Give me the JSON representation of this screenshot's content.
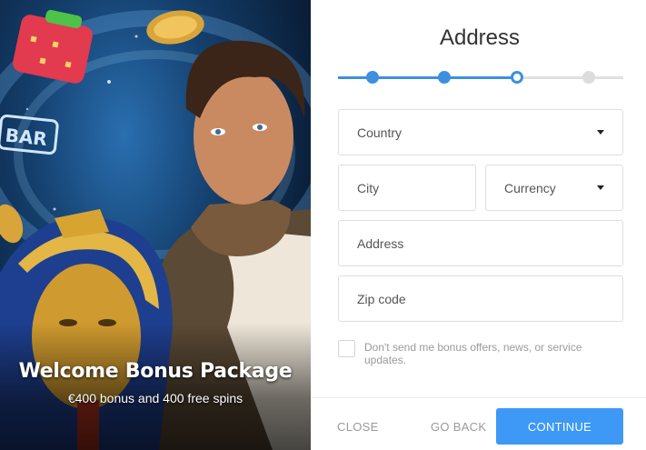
{
  "promo": {
    "title": "Welcome Bonus Package",
    "subtitle": "€400 bonus and 400 free spins",
    "icons": [
      "strawberry-icon",
      "bar-symbol-icon",
      "coin-icon",
      "explorer-illustration",
      "pharaoh-illustration"
    ]
  },
  "form": {
    "title": "Address",
    "stepper": {
      "total_steps": 4,
      "current_step": 3
    },
    "fields": {
      "country": {
        "placeholder": "Country"
      },
      "city": {
        "placeholder": "City"
      },
      "currency": {
        "placeholder": "Currency"
      },
      "address": {
        "placeholder": "Address"
      },
      "zip": {
        "placeholder": "Zip code"
      }
    },
    "consent_label": "Don't send me bonus offers, news, or service updates.",
    "buttons": {
      "close": "CLOSE",
      "back": "GO BACK",
      "continue": "CONTINUE"
    }
  },
  "colors": {
    "accent": "#3d99f5",
    "stepper": "#3d8fe0",
    "muted_text": "#9a9a9a"
  }
}
